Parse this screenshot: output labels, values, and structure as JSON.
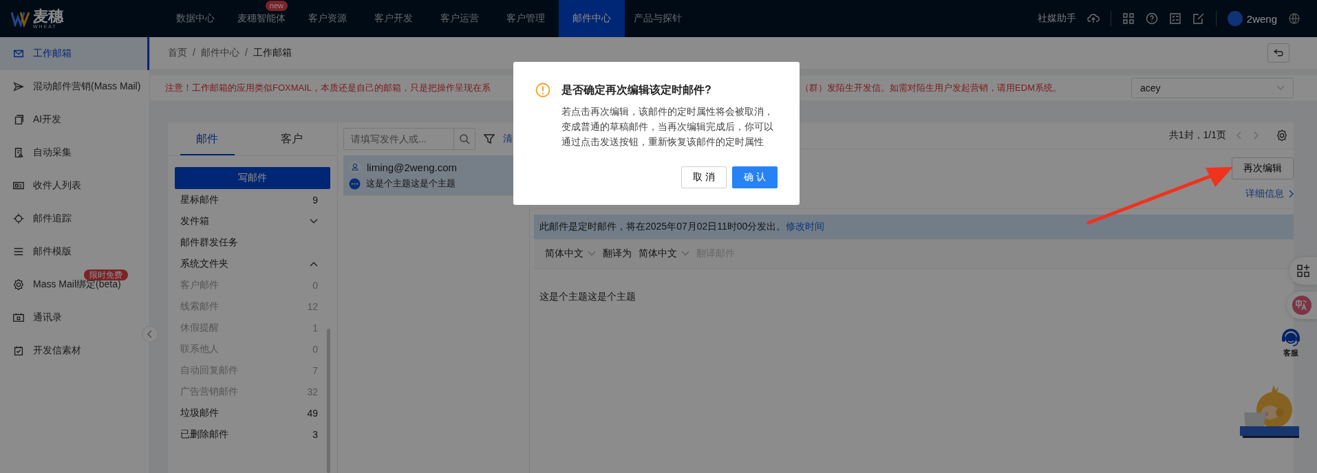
{
  "topbar": {
    "logo_text": "麦穗",
    "logo_subtext": "WHEAT",
    "nav": [
      {
        "label": "数据中心",
        "selected": false
      },
      {
        "label": "麦穗智能体",
        "selected": false,
        "badge": "new"
      },
      {
        "label": "客户资源",
        "selected": false
      },
      {
        "label": "客户开发",
        "selected": false
      },
      {
        "label": "客户运营",
        "selected": false
      },
      {
        "label": "客户管理",
        "selected": false
      },
      {
        "label": "邮件中心",
        "selected": true
      },
      {
        "label": "产品与探针",
        "selected": false
      }
    ],
    "assistant": "社媒助手",
    "user_name": "2weng"
  },
  "sidebar": {
    "items": [
      {
        "label": "工作邮箱",
        "selected": true
      },
      {
        "label": "混动邮件营销(Mass Mail)",
        "selected": false
      },
      {
        "label": "AI开发",
        "selected": false
      },
      {
        "label": "自动采集",
        "selected": false
      },
      {
        "label": "收件人列表",
        "selected": false
      },
      {
        "label": "邮件追踪",
        "selected": false
      },
      {
        "label": "邮件模版",
        "selected": false
      },
      {
        "label": "Mass Mail绑定(beta)",
        "selected": false,
        "badge": "限时免费"
      },
      {
        "label": "通讯录",
        "selected": false
      },
      {
        "label": "开发信素材",
        "selected": false
      }
    ]
  },
  "breadcrumb": {
    "separator": "/",
    "items": [
      "首页",
      "邮件中心",
      "工作邮箱"
    ]
  },
  "notice": {
    "text_start": "注意！工作邮箱的应用类似FOXMAIL，本质还是自己的邮箱，只是把操作呈现在系",
    "text_end": "（群）发陌生开发信。如需对陌生用户发起营销，请用EDM系统。"
  },
  "account_select": {
    "value": "acey"
  },
  "folder_tabs": [
    {
      "label": "邮件",
      "selected": true
    },
    {
      "label": "客户",
      "selected": false
    }
  ],
  "compose_button": "写邮件",
  "folders": [
    {
      "label": "星标邮件",
      "count": "9",
      "muted": false
    },
    {
      "label": "发件箱",
      "expanded": false,
      "muted": false
    },
    {
      "label": "邮件群发任务",
      "muted": false
    },
    {
      "label": "系统文件夹",
      "expanded": true,
      "muted": false
    },
    {
      "label": "客户邮件",
      "count": "0",
      "muted": true
    },
    {
      "label": "线索邮件",
      "count": "12",
      "muted": true
    },
    {
      "label": "休假提醒",
      "count": "1",
      "muted": true
    },
    {
      "label": "联系他人",
      "count": "0",
      "muted": true
    },
    {
      "label": "自动回复邮件",
      "count": "7",
      "muted": true
    },
    {
      "label": "广告营销邮件",
      "count": "32",
      "muted": true
    },
    {
      "label": "垃圾邮件",
      "count": "49",
      "muted": false
    },
    {
      "label": "已删除邮件",
      "count": "3",
      "muted": false
    }
  ],
  "mail_search": {
    "placeholder": "请填写发件人或...",
    "clear": "清"
  },
  "mails": [
    {
      "sender": "liming@2weng.com",
      "subject": "这是个主题这是个主题",
      "selected": true
    }
  ],
  "detail": {
    "pagination": "共1封，1/1页",
    "reedit_button": "再次编辑",
    "details_link": "详细信息",
    "banner_text": "此邮件是定时邮件，将在2025年07月02日11时00分发出。",
    "banner_link": "修改时间",
    "source_language": "简体中文",
    "translate_label": "翻译为",
    "target_language": "简体中文",
    "translate_button": {
      "label": "翻译邮件",
      "disabled": true
    },
    "body": "这是个主题这是个主题"
  },
  "support": {
    "label": "客服"
  },
  "dialog": {
    "title": "是否确定再次编辑该定时邮件?",
    "message_lines": [
      "若点击再次编辑，该邮件的定时属性将会被取消，",
      "变成普通的草稿邮件，当再次编辑完成后，你可以",
      "通过点击发送按钮，重新恢复该邮件的定时属性"
    ],
    "buttons": [
      {
        "label": "取 消",
        "kind": "default"
      },
      {
        "label": "确 认",
        "kind": "primary"
      }
    ]
  }
}
